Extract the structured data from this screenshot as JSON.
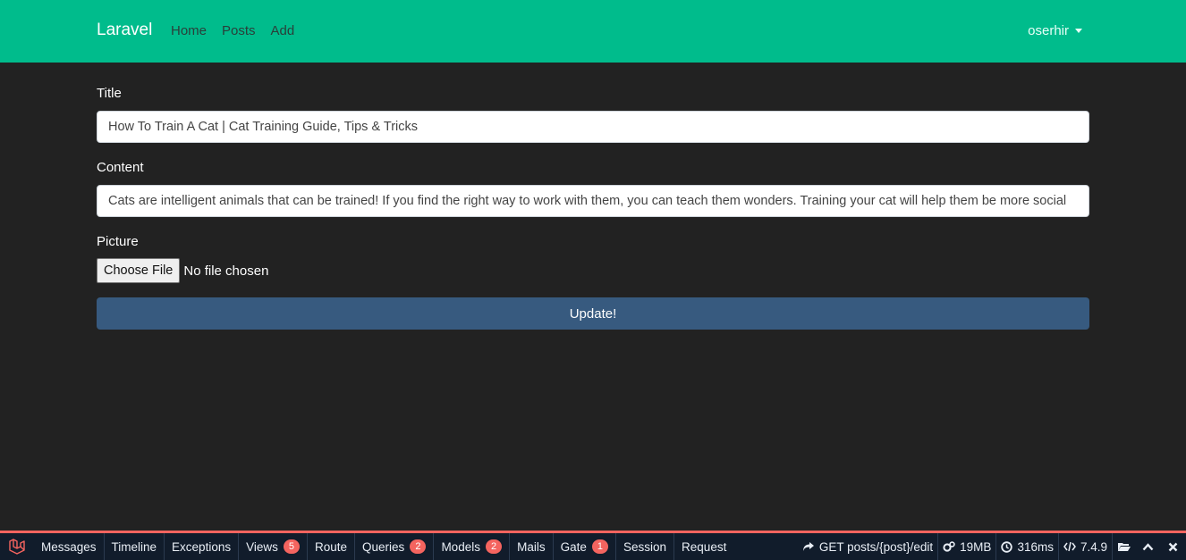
{
  "navbar": {
    "brand": "Laravel",
    "links": [
      "Home",
      "Posts",
      "Add"
    ],
    "user": "oserhir",
    "color": "#00bc8c"
  },
  "form": {
    "title_label": "Title",
    "title_value": "How To Train A Cat | Cat Training Guide, Tips & Tricks",
    "content_label": "Content",
    "content_value": "Cats are intelligent animals that can be trained! If you find the right way to work with them, you can teach them wonders. Training your cat will help them be more social",
    "picture_label": "Picture",
    "choose_file": "Choose File",
    "no_file": "No file chosen",
    "submit": "Update!"
  },
  "debugbar": {
    "tabs": [
      {
        "label": "Messages",
        "badge": ""
      },
      {
        "label": "Timeline",
        "badge": ""
      },
      {
        "label": "Exceptions",
        "badge": ""
      },
      {
        "label": "Views",
        "badge": "5"
      },
      {
        "label": "Route",
        "badge": ""
      },
      {
        "label": "Queries",
        "badge": "2"
      },
      {
        "label": "Models",
        "badge": "2"
      },
      {
        "label": "Mails",
        "badge": ""
      },
      {
        "label": "Gate",
        "badge": "1"
      },
      {
        "label": "Session",
        "badge": ""
      },
      {
        "label": "Request",
        "badge": ""
      }
    ],
    "route": "GET posts/{post}/edit",
    "memory": "19MB",
    "time": "316ms",
    "php_version": "7.4.9",
    "accent": "#f4645f"
  }
}
